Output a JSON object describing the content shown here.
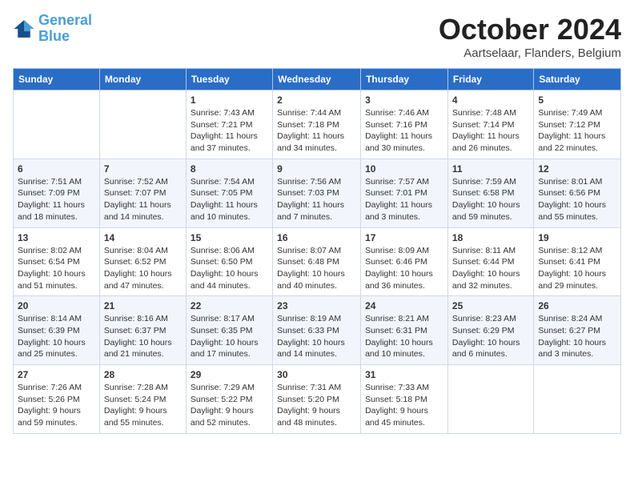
{
  "header": {
    "logo_line1": "General",
    "logo_line2": "Blue",
    "month": "October 2024",
    "location": "Aartselaar, Flanders, Belgium"
  },
  "days_of_week": [
    "Sunday",
    "Monday",
    "Tuesday",
    "Wednesday",
    "Thursday",
    "Friday",
    "Saturday"
  ],
  "weeks": [
    [
      {
        "num": "",
        "sunrise": "",
        "sunset": "",
        "daylight": ""
      },
      {
        "num": "",
        "sunrise": "",
        "sunset": "",
        "daylight": ""
      },
      {
        "num": "1",
        "sunrise": "Sunrise: 7:43 AM",
        "sunset": "Sunset: 7:21 PM",
        "daylight": "Daylight: 11 hours and 37 minutes."
      },
      {
        "num": "2",
        "sunrise": "Sunrise: 7:44 AM",
        "sunset": "Sunset: 7:18 PM",
        "daylight": "Daylight: 11 hours and 34 minutes."
      },
      {
        "num": "3",
        "sunrise": "Sunrise: 7:46 AM",
        "sunset": "Sunset: 7:16 PM",
        "daylight": "Daylight: 11 hours and 30 minutes."
      },
      {
        "num": "4",
        "sunrise": "Sunrise: 7:48 AM",
        "sunset": "Sunset: 7:14 PM",
        "daylight": "Daylight: 11 hours and 26 minutes."
      },
      {
        "num": "5",
        "sunrise": "Sunrise: 7:49 AM",
        "sunset": "Sunset: 7:12 PM",
        "daylight": "Daylight: 11 hours and 22 minutes."
      }
    ],
    [
      {
        "num": "6",
        "sunrise": "Sunrise: 7:51 AM",
        "sunset": "Sunset: 7:09 PM",
        "daylight": "Daylight: 11 hours and 18 minutes."
      },
      {
        "num": "7",
        "sunrise": "Sunrise: 7:52 AM",
        "sunset": "Sunset: 7:07 PM",
        "daylight": "Daylight: 11 hours and 14 minutes."
      },
      {
        "num": "8",
        "sunrise": "Sunrise: 7:54 AM",
        "sunset": "Sunset: 7:05 PM",
        "daylight": "Daylight: 11 hours and 10 minutes."
      },
      {
        "num": "9",
        "sunrise": "Sunrise: 7:56 AM",
        "sunset": "Sunset: 7:03 PM",
        "daylight": "Daylight: 11 hours and 7 minutes."
      },
      {
        "num": "10",
        "sunrise": "Sunrise: 7:57 AM",
        "sunset": "Sunset: 7:01 PM",
        "daylight": "Daylight: 11 hours and 3 minutes."
      },
      {
        "num": "11",
        "sunrise": "Sunrise: 7:59 AM",
        "sunset": "Sunset: 6:58 PM",
        "daylight": "Daylight: 10 hours and 59 minutes."
      },
      {
        "num": "12",
        "sunrise": "Sunrise: 8:01 AM",
        "sunset": "Sunset: 6:56 PM",
        "daylight": "Daylight: 10 hours and 55 minutes."
      }
    ],
    [
      {
        "num": "13",
        "sunrise": "Sunrise: 8:02 AM",
        "sunset": "Sunset: 6:54 PM",
        "daylight": "Daylight: 10 hours and 51 minutes."
      },
      {
        "num": "14",
        "sunrise": "Sunrise: 8:04 AM",
        "sunset": "Sunset: 6:52 PM",
        "daylight": "Daylight: 10 hours and 47 minutes."
      },
      {
        "num": "15",
        "sunrise": "Sunrise: 8:06 AM",
        "sunset": "Sunset: 6:50 PM",
        "daylight": "Daylight: 10 hours and 44 minutes."
      },
      {
        "num": "16",
        "sunrise": "Sunrise: 8:07 AM",
        "sunset": "Sunset: 6:48 PM",
        "daylight": "Daylight: 10 hours and 40 minutes."
      },
      {
        "num": "17",
        "sunrise": "Sunrise: 8:09 AM",
        "sunset": "Sunset: 6:46 PM",
        "daylight": "Daylight: 10 hours and 36 minutes."
      },
      {
        "num": "18",
        "sunrise": "Sunrise: 8:11 AM",
        "sunset": "Sunset: 6:44 PM",
        "daylight": "Daylight: 10 hours and 32 minutes."
      },
      {
        "num": "19",
        "sunrise": "Sunrise: 8:12 AM",
        "sunset": "Sunset: 6:41 PM",
        "daylight": "Daylight: 10 hours and 29 minutes."
      }
    ],
    [
      {
        "num": "20",
        "sunrise": "Sunrise: 8:14 AM",
        "sunset": "Sunset: 6:39 PM",
        "daylight": "Daylight: 10 hours and 25 minutes."
      },
      {
        "num": "21",
        "sunrise": "Sunrise: 8:16 AM",
        "sunset": "Sunset: 6:37 PM",
        "daylight": "Daylight: 10 hours and 21 minutes."
      },
      {
        "num": "22",
        "sunrise": "Sunrise: 8:17 AM",
        "sunset": "Sunset: 6:35 PM",
        "daylight": "Daylight: 10 hours and 17 minutes."
      },
      {
        "num": "23",
        "sunrise": "Sunrise: 8:19 AM",
        "sunset": "Sunset: 6:33 PM",
        "daylight": "Daylight: 10 hours and 14 minutes."
      },
      {
        "num": "24",
        "sunrise": "Sunrise: 8:21 AM",
        "sunset": "Sunset: 6:31 PM",
        "daylight": "Daylight: 10 hours and 10 minutes."
      },
      {
        "num": "25",
        "sunrise": "Sunrise: 8:23 AM",
        "sunset": "Sunset: 6:29 PM",
        "daylight": "Daylight: 10 hours and 6 minutes."
      },
      {
        "num": "26",
        "sunrise": "Sunrise: 8:24 AM",
        "sunset": "Sunset: 6:27 PM",
        "daylight": "Daylight: 10 hours and 3 minutes."
      }
    ],
    [
      {
        "num": "27",
        "sunrise": "Sunrise: 7:26 AM",
        "sunset": "Sunset: 5:26 PM",
        "daylight": "Daylight: 9 hours and 59 minutes."
      },
      {
        "num": "28",
        "sunrise": "Sunrise: 7:28 AM",
        "sunset": "Sunset: 5:24 PM",
        "daylight": "Daylight: 9 hours and 55 minutes."
      },
      {
        "num": "29",
        "sunrise": "Sunrise: 7:29 AM",
        "sunset": "Sunset: 5:22 PM",
        "daylight": "Daylight: 9 hours and 52 minutes."
      },
      {
        "num": "30",
        "sunrise": "Sunrise: 7:31 AM",
        "sunset": "Sunset: 5:20 PM",
        "daylight": "Daylight: 9 hours and 48 minutes."
      },
      {
        "num": "31",
        "sunrise": "Sunrise: 7:33 AM",
        "sunset": "Sunset: 5:18 PM",
        "daylight": "Daylight: 9 hours and 45 minutes."
      },
      {
        "num": "",
        "sunrise": "",
        "sunset": "",
        "daylight": ""
      },
      {
        "num": "",
        "sunrise": "",
        "sunset": "",
        "daylight": ""
      }
    ]
  ]
}
